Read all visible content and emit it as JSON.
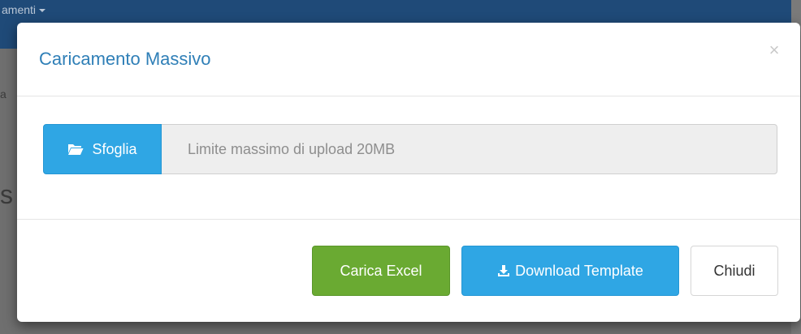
{
  "background": {
    "navbar_text": "amenti",
    "snippet_a": "a",
    "snippet_b": "s"
  },
  "modal": {
    "title": "Caricamento Massivo",
    "close_glyph": "×",
    "browse_label": "Sfoglia",
    "file_placeholder": "Limite massimo di upload 20MB",
    "buttons": {
      "excel": "Carica Excel",
      "template": "Download Template",
      "close": "Chiudi"
    },
    "icons": {
      "browse": "folder-open-icon",
      "template": "download-icon"
    }
  },
  "colors": {
    "title": "#2f7fb7",
    "primary": "#2fa6e4",
    "success": "#6aaa32",
    "navbar": "#1f4a78"
  }
}
